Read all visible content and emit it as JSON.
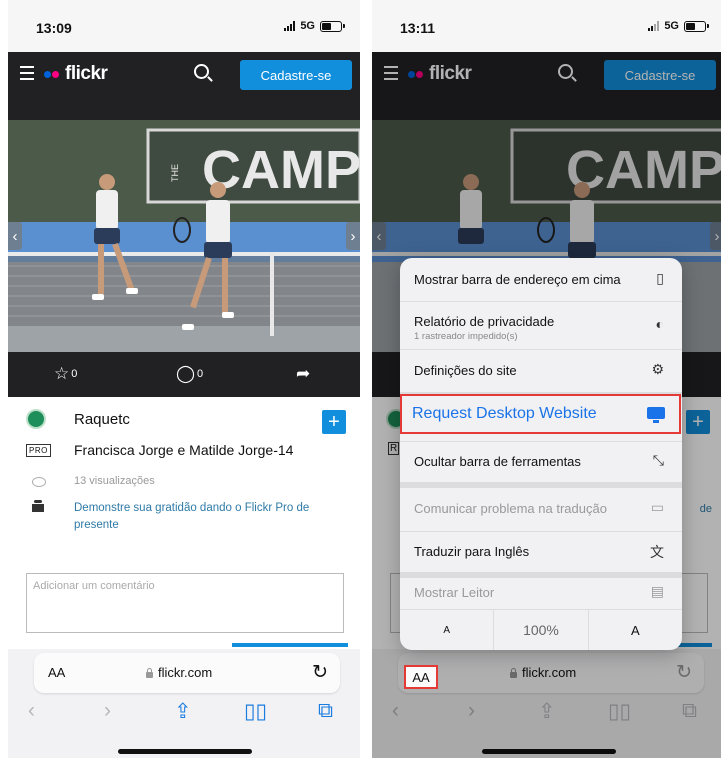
{
  "left": {
    "time": "13:09",
    "network": "5G",
    "logo": "flickr",
    "signup": "Cadastre-se",
    "favorites": "0",
    "comments": "0",
    "author": "Raquetc",
    "pro_badge": "PRO",
    "photo_title": "Francisca Jorge e Matilde Jorge-14",
    "views": "13 visualizações",
    "gratitude_link": "Demonstre sua gratidão dando o Flickr Pro de presente",
    "comment_placeholder": "Adicionar um comentário",
    "aa": "AA",
    "url": "flickr.com"
  },
  "right": {
    "time": "13:11",
    "network": "5G",
    "logo": "flickr",
    "signup": "Cadastre-se",
    "aa": "AA",
    "url": "flickr.com",
    "side_letter": "R",
    "side_text": "de",
    "menu": {
      "show_address_top": "Mostrar barra de endereço em cima",
      "privacy_report": "Relatório de privacidade",
      "privacy_sub": "1 rastreador impedido(s)",
      "site_settings": "Definições do site",
      "request_desktop": "Request Desktop Website",
      "hide_toolbar": "Ocultar barra de ferramentas",
      "report_translation": "Comunicar problema na tradução",
      "translate": "Traduzir para Inglês",
      "show_reader": "Mostrar Leitor",
      "font_small": "A",
      "zoom": "100%",
      "font_large": "A"
    }
  },
  "photo_text": "CAMPU",
  "photo_text_small": "THE",
  "colors": {
    "accent": "#128fdc",
    "dark": "#212124",
    "highlight": "#e53935",
    "link": "#1a73e8"
  }
}
